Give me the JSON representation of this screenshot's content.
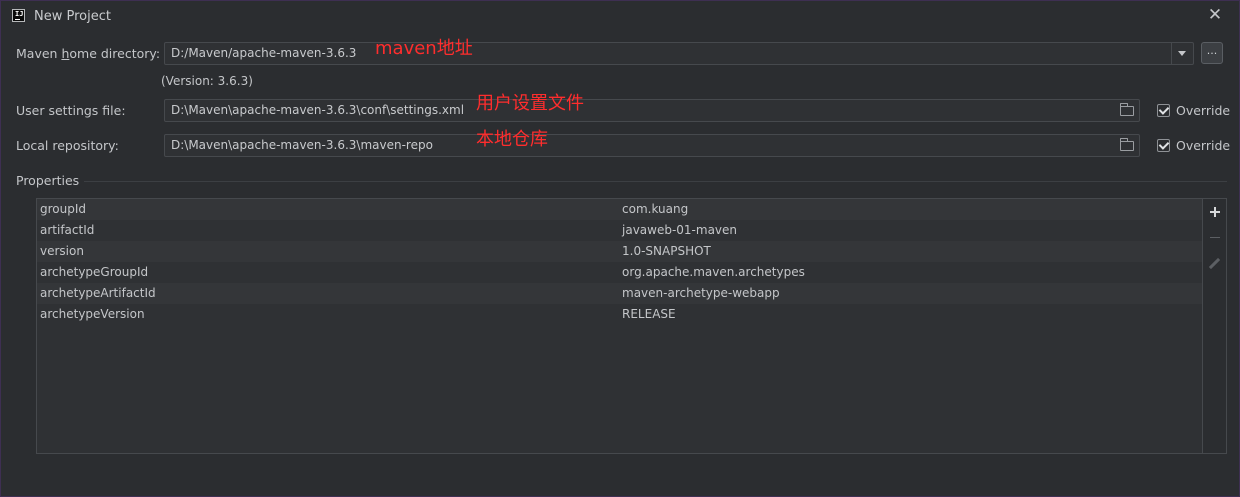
{
  "window": {
    "title": "New Project",
    "app_icon_text": "IJ"
  },
  "maven_home": {
    "label": "Maven home directory:",
    "mnemonic_letter": "h",
    "value": "D:/Maven/apache-maven-3.6.3",
    "version_text": "(Version: 3.6.3)",
    "ellipsis_label": "...",
    "annotation": "maven地址"
  },
  "user_settings": {
    "label": "User settings file:",
    "value": "D:\\Maven\\apache-maven-3.6.3\\conf\\settings.xml",
    "override_label": "Override",
    "override_checked": true,
    "annotation": "用户设置文件"
  },
  "local_repo": {
    "label": "Local repository:",
    "value": "D:\\Maven\\apache-maven-3.6.3\\maven-repo",
    "override_label": "Override",
    "override_checked": true,
    "annotation": "本地仓库"
  },
  "properties": {
    "title": "Properties",
    "rows": [
      {
        "key": "groupId",
        "value": "com.kuang"
      },
      {
        "key": "artifactId",
        "value": "javaweb-01-maven"
      },
      {
        "key": "version",
        "value": "1.0-SNAPSHOT"
      },
      {
        "key": "archetypeGroupId",
        "value": "org.apache.maven.archetypes"
      },
      {
        "key": "archetypeArtifactId",
        "value": "maven-archetype-webapp"
      },
      {
        "key": "archetypeVersion",
        "value": "RELEASE"
      }
    ],
    "toolbar": [
      "add-icon",
      "remove-icon",
      "edit-icon"
    ]
  },
  "colors": {
    "background": "#2b2d30",
    "annotation": "#ff2d2d",
    "field_border": "#46494d"
  }
}
